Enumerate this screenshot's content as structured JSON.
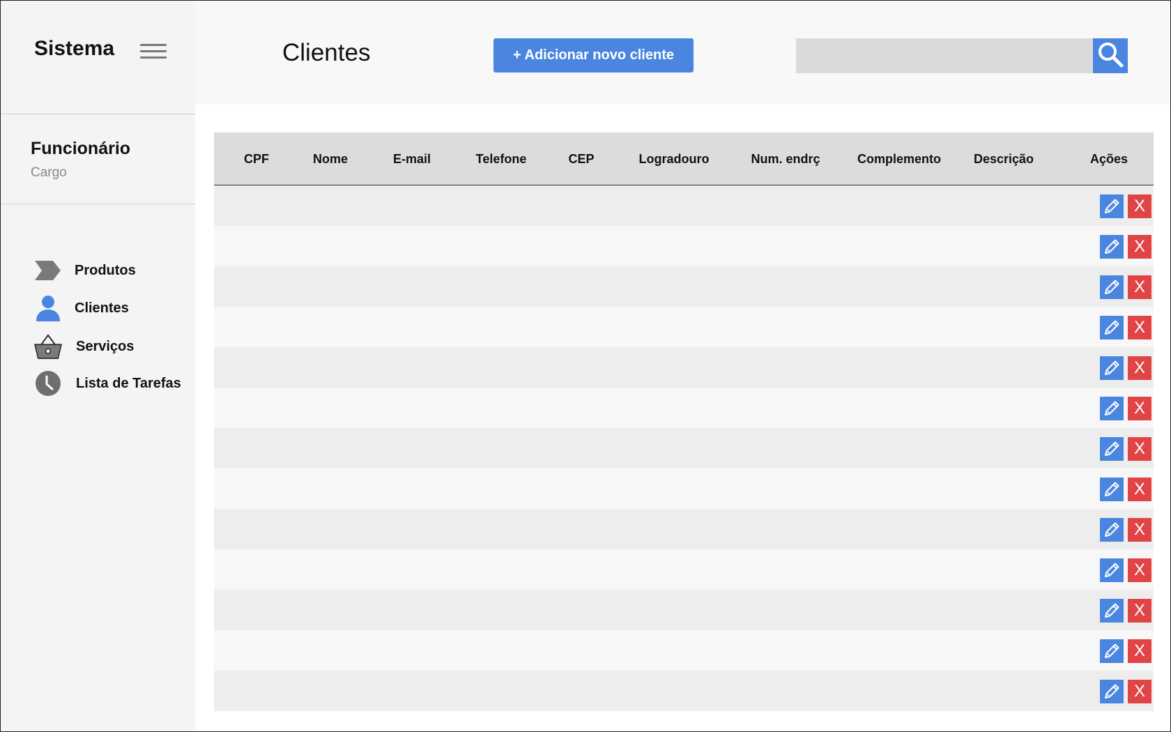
{
  "sidebar": {
    "brand": "Sistema",
    "user": {
      "name": "Funcionário",
      "role": "Cargo"
    },
    "items": [
      {
        "label": "Produtos",
        "icon": "chevron-tag-icon"
      },
      {
        "label": "Clientes",
        "icon": "person-icon"
      },
      {
        "label": "Serviços",
        "icon": "basket-icon"
      },
      {
        "label": "Lista de Tarefas",
        "icon": "clock-icon"
      }
    ]
  },
  "header": {
    "title": "Clientes",
    "add_button_label": "+ Adicionar novo cliente",
    "search_placeholder": ""
  },
  "table": {
    "columns": [
      "CPF",
      "Nome",
      "E-mail",
      "Telefone",
      "CEP",
      "Logradouro",
      "Num. endrç",
      "Complemento",
      "Descrição",
      "Ações"
    ],
    "row_count": 13,
    "delete_label": "X"
  },
  "colors": {
    "accent": "#4a86e0",
    "danger": "#e04444"
  }
}
